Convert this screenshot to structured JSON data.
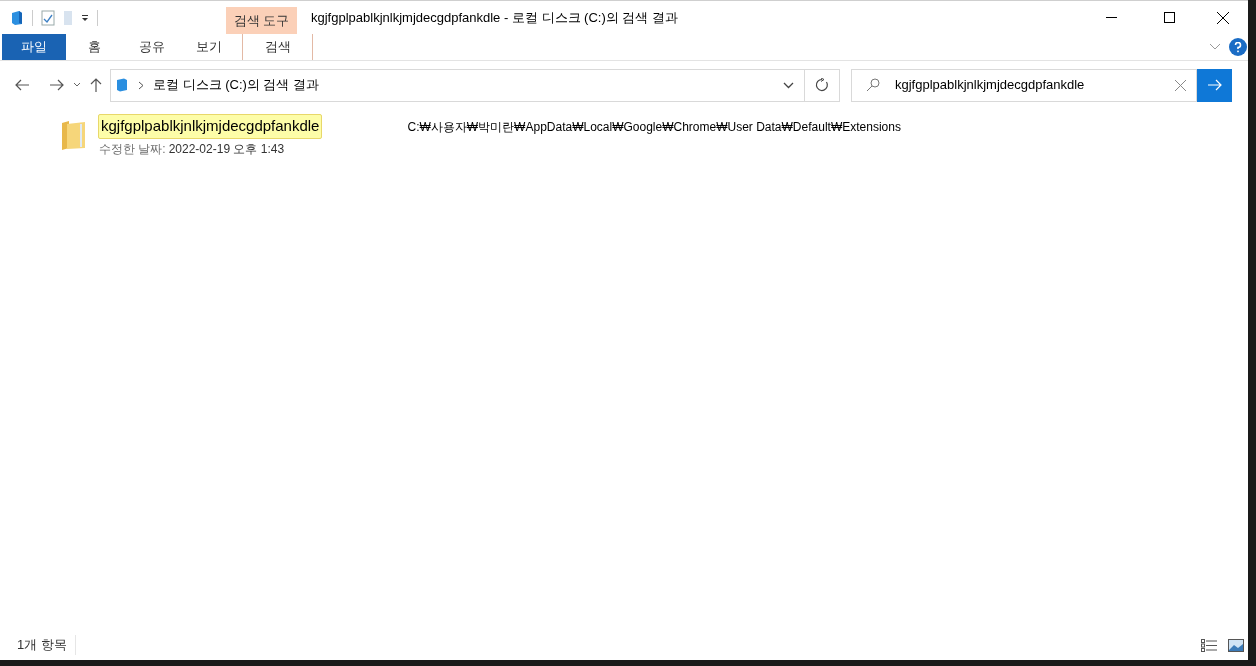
{
  "window": {
    "title": "kgjfgplpablkjnlkjmjdecgdpfankdle - 로컬 디스크 (C:)의 검색 결과",
    "context_group": "검색 도구"
  },
  "ribbon_tabs": [
    {
      "label": "파일",
      "kind": "file"
    },
    {
      "label": "홈",
      "kind": "plain"
    },
    {
      "label": "공유",
      "kind": "plain"
    },
    {
      "label": "보기",
      "kind": "plain"
    },
    {
      "label": "검색",
      "kind": "contextual"
    }
  ],
  "address_bar": {
    "path": "로컬 디스크 (C:)의 검색 결과"
  },
  "search": {
    "value": "kgjfgplpablkjnlkjmjdecgdpfankdle"
  },
  "results": [
    {
      "name": "kgjfgplpablkjnlkjmjdecgdpfankdle",
      "selected": true,
      "modified_label": "수정한 날짜:",
      "modified": "2022-02-19 오후 1:43",
      "location": "C:₩사용자₩박미란₩AppData₩Local₩Google₩Chrome₩User Data₩Default₩Extensions"
    }
  ],
  "status_bar": {
    "count": "1개 항목"
  }
}
